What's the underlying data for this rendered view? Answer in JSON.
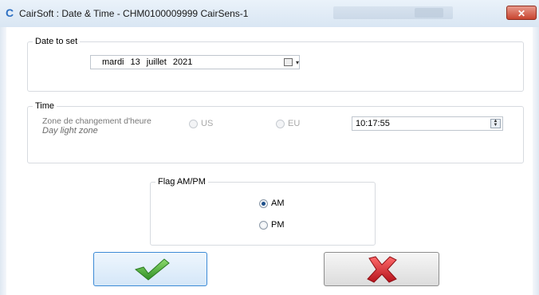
{
  "window": {
    "icon_glyph": "C",
    "title": "CairSoft : Date & Time - CHM0100009999 CairSens-1",
    "close_glyph": "✕"
  },
  "date_group": {
    "legend": "Date to set",
    "weekday": "mardi",
    "day": "13",
    "month": "juillet",
    "year": "2021",
    "dropdown_glyph": "▾"
  },
  "time_group": {
    "legend": "Time",
    "zone_label": "Zone de changement d'heure",
    "zone_label_en": "Day light zone",
    "option_us": "US",
    "option_eu": "EU",
    "time_value": "10:17:55",
    "spin_up": "▲",
    "spin_down": "▼"
  },
  "ampm_group": {
    "legend": "Flag AM/PM",
    "option_am": "AM",
    "option_pm": "PM",
    "selected": "AM"
  },
  "buttons": {
    "ok_icon": "checkmark-icon",
    "cancel_icon": "cross-icon"
  },
  "colors": {
    "ok_check": "#4fae3a",
    "cancel_cross": "#d8232a",
    "ok_border": "#3c8ad6"
  }
}
